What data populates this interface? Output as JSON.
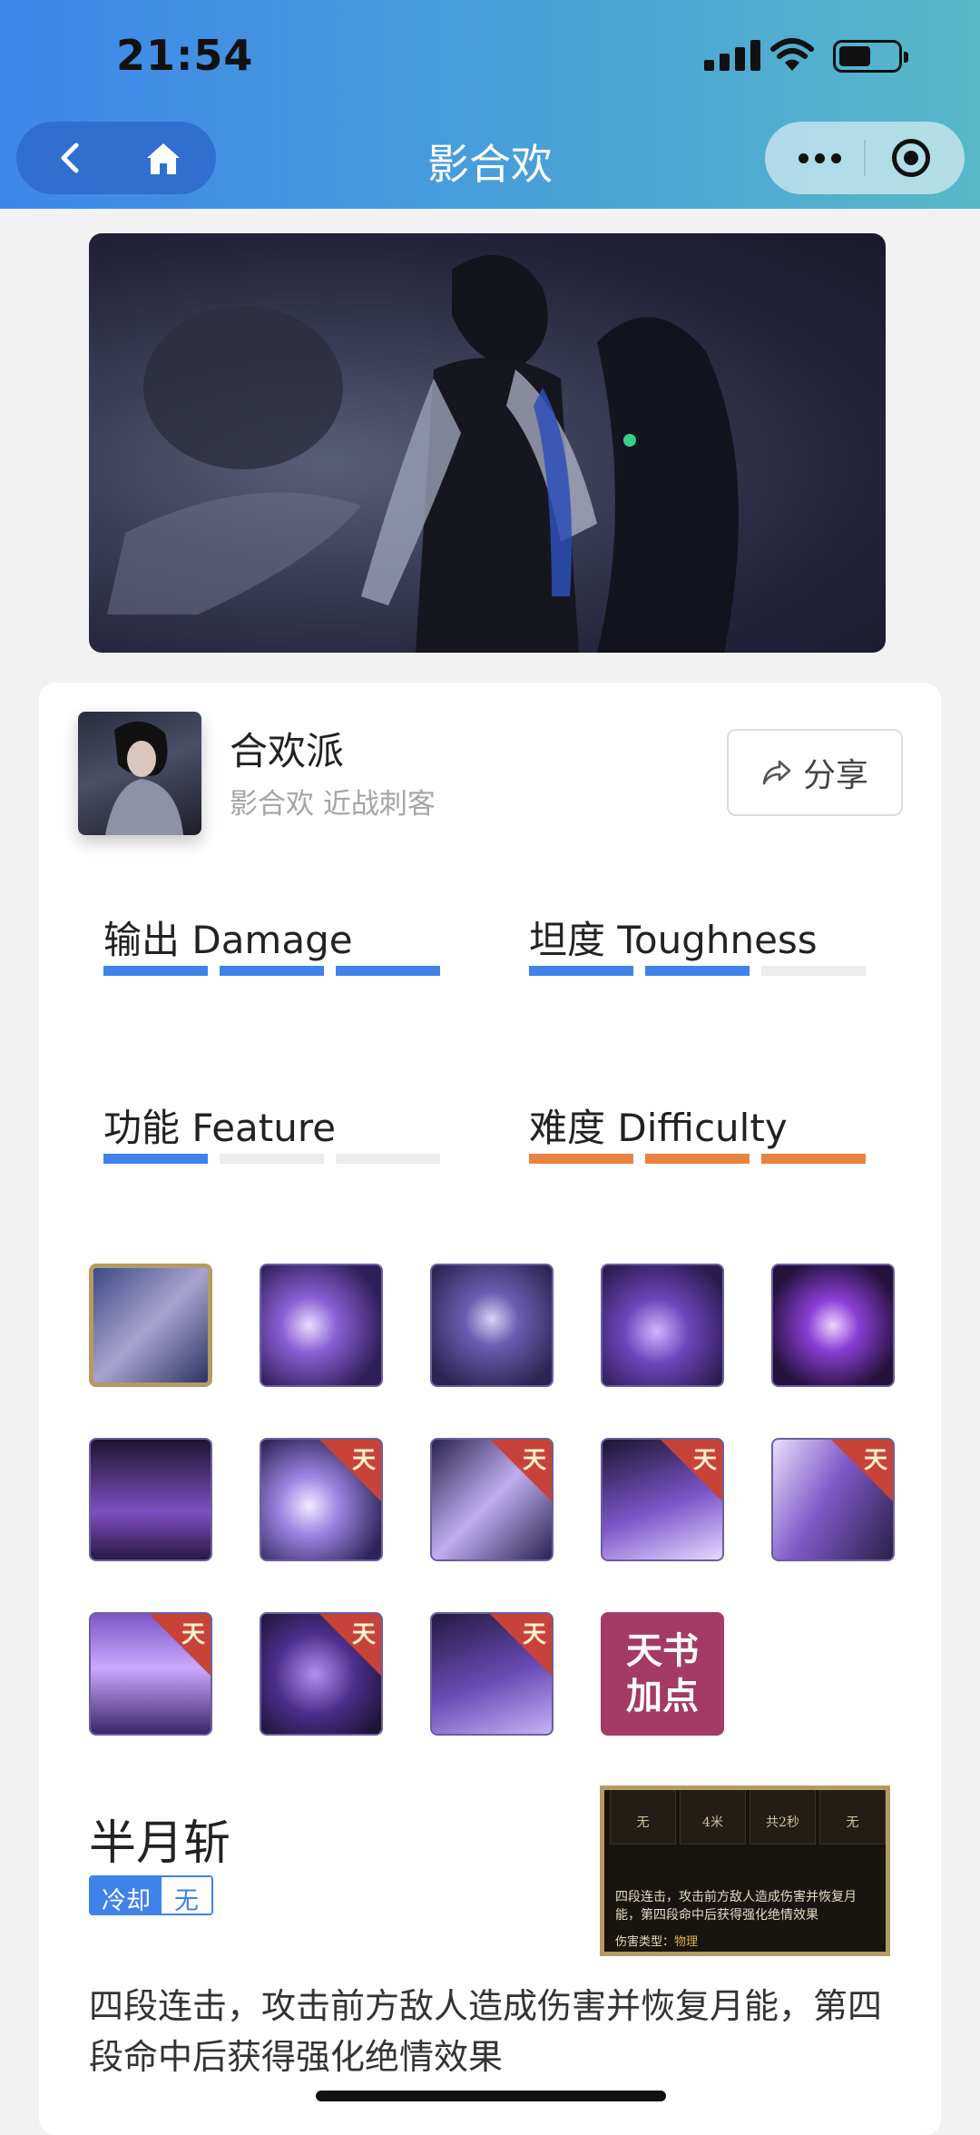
{
  "status_bar": {
    "time": "21:54"
  },
  "nav": {
    "title": "影合欢"
  },
  "profile": {
    "sect_name": "合欢派",
    "sect_subtitle": "影合欢 近战刺客",
    "share_label": "分享"
  },
  "stats": [
    {
      "label": "输出 Damage",
      "level": 3,
      "max": 3,
      "color": "#3f82e9"
    },
    {
      "label": "坦度 Toughness",
      "level": 2,
      "max": 3,
      "color": "#3f82e9"
    },
    {
      "label": "功能 Feature",
      "level": 1,
      "max": 3,
      "color": "#3f82e9"
    },
    {
      "label": "难度 Difficulty",
      "level": 3,
      "max": 3,
      "color": "#e9823f"
    }
  ],
  "skills": {
    "tian_badge": "天",
    "book_line1": "天书",
    "book_line2": "加点"
  },
  "selected_skill": {
    "name": "半月斩",
    "cooldown_key": "冷却",
    "cooldown_value": "无",
    "description": "四段连击，攻击前方敌人造成伤害并恢复月能，第四段命中后获得强化绝情效果",
    "preview": {
      "cells": [
        "无",
        "4米",
        "共2秒",
        "无"
      ],
      "text": "四段连击，攻击前方敌人造成伤害并恢复月能，第四段命中后获得强化绝情效果",
      "damage_label": "伤害类型：",
      "damage_value": "物理"
    }
  }
}
